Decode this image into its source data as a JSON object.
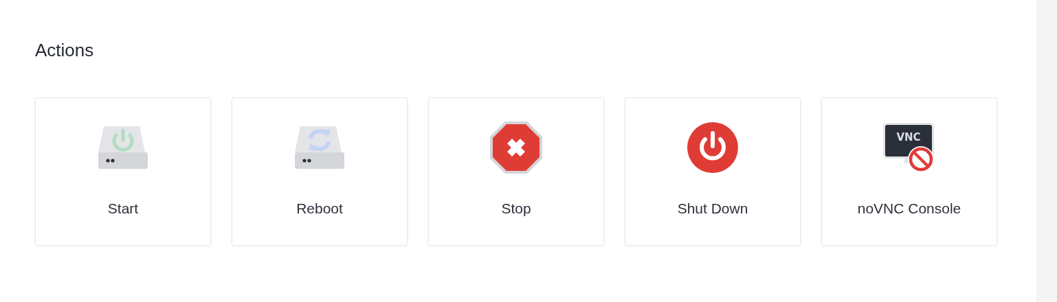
{
  "section": {
    "title": "Actions"
  },
  "actions": [
    {
      "label": "Start",
      "kind": "start"
    },
    {
      "label": "Reboot",
      "kind": "reboot"
    },
    {
      "label": "Stop",
      "kind": "stop"
    },
    {
      "label": "Shut Down",
      "kind": "shutdown"
    },
    {
      "label": "noVNC Console",
      "kind": "console",
      "icon_text": "VNC"
    }
  ]
}
